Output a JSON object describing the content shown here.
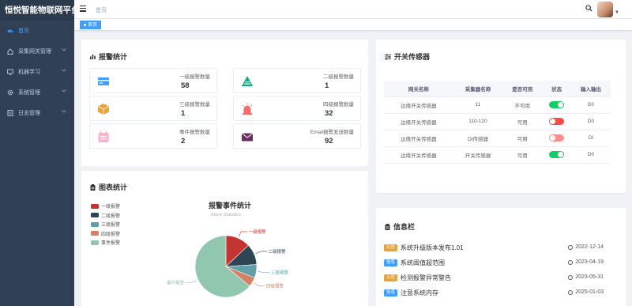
{
  "app": {
    "title": "恒悦智能物联网平台"
  },
  "sidebar": {
    "items": [
      {
        "label": "首页",
        "icon": "dashboard-icon",
        "active": true,
        "has_children": false
      },
      {
        "label": "采集网关管理",
        "icon": "home-icon",
        "active": false,
        "has_children": true
      },
      {
        "label": "机器学习",
        "icon": "monitor-icon",
        "active": false,
        "has_children": true
      },
      {
        "label": "系统管理",
        "icon": "gear-icon",
        "active": false,
        "has_children": true
      },
      {
        "label": "日志管理",
        "icon": "log-icon",
        "active": false,
        "has_children": true
      }
    ]
  },
  "header": {
    "breadcrumb": "首页"
  },
  "tags": [
    {
      "label": "首页"
    }
  ],
  "alarm_stats": {
    "title": "报警统计",
    "items": [
      {
        "label": "一级报警数量",
        "value": "58",
        "icon": "card-icon",
        "color": "#409eff"
      },
      {
        "label": "二级报警数量",
        "value": "1",
        "icon": "warning-triangle-icon",
        "color": "#13a97e"
      },
      {
        "label": "三级报警数量",
        "value": "1",
        "icon": "box-icon",
        "color": "#e6a23c"
      },
      {
        "label": "四级报警数量",
        "value": "32",
        "icon": "alarm-light-icon",
        "color": "#f56c6c"
      },
      {
        "label": "事件报警数量",
        "value": "2",
        "icon": "calendar-icon",
        "color": "#f5a3c0"
      },
      {
        "label": "Email报警发送数量",
        "value": "92",
        "icon": "mail-icon",
        "color": "#6b2f5f"
      }
    ]
  },
  "switch_sensors": {
    "title": "开关传感器",
    "columns": [
      "网关名称",
      "采集器名称",
      "是否可用",
      "状态",
      "输入输出"
    ],
    "rows": [
      {
        "gateway": "边缘开关传感器",
        "collector": "11",
        "available": "不可用",
        "status": "on",
        "status_color": "#13ce66",
        "io": "D0"
      },
      {
        "gateway": "边缘开关传感器",
        "collector": "110-120",
        "available": "可用",
        "status": "off",
        "status_color": "#ff4949",
        "io": "D0"
      },
      {
        "gateway": "边缘开关传感器",
        "collector": "DI传感器",
        "available": "可用",
        "status": "off",
        "status_color": "#fb8e8e",
        "io": "DI"
      },
      {
        "gateway": "边缘开关传感器",
        "collector": "开关传感器",
        "available": "可用",
        "status": "on",
        "status_color": "#13ce66",
        "io": "D0"
      }
    ]
  },
  "chart_panel": {
    "title": "图表统计"
  },
  "chart_data": {
    "type": "pie",
    "title": "报警事件统计",
    "subtitle": "Alarm Statistics",
    "legend_position": "top-left",
    "categories": [
      "一级报警",
      "二级报警",
      "三级报警",
      "四级报警",
      "事件报警"
    ],
    "values": [
      13,
      11,
      7,
      5,
      64
    ],
    "colors": [
      "#c23531",
      "#2f4554",
      "#61a0a8",
      "#d48265",
      "#91c7ae"
    ]
  },
  "info_panel": {
    "title": "信息栏",
    "items": [
      {
        "badge": "公告",
        "badge_color": "#e6a23c",
        "text": "系统升级版本发布1.01",
        "date": "2022-12-14"
      },
      {
        "badge": "信息",
        "badge_color": "#409eff",
        "text": "系统阈值超范围",
        "date": "2023-04-19"
      },
      {
        "badge": "公告",
        "badge_color": "#e6a23c",
        "text": "检测报警异常警告",
        "date": "2023-05-31"
      },
      {
        "badge": "信息",
        "badge_color": "#409eff",
        "text": "注意系统内存",
        "date": "2025-01-03"
      }
    ]
  }
}
